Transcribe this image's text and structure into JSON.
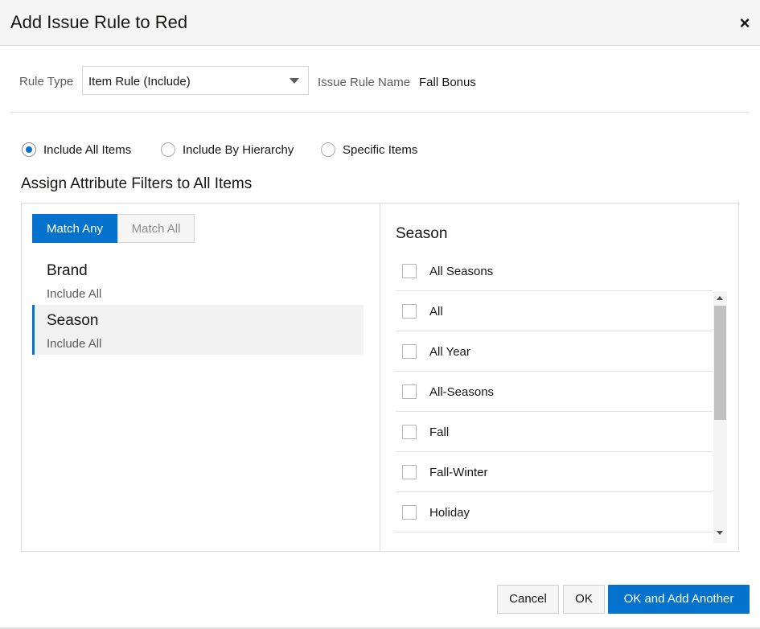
{
  "dialog": {
    "title": "Add Issue Rule to Red",
    "close_glyph": "×"
  },
  "form": {
    "rule_type_label": "Rule Type",
    "rule_type_value": "Item Rule (Include)",
    "issue_rule_name_label": "Issue Rule Name",
    "issue_rule_name_value": "Fall Bonus"
  },
  "radios": [
    {
      "label": "Include All Items",
      "checked": true
    },
    {
      "label": "Include By Hierarchy",
      "checked": false
    },
    {
      "label": "Specific Items",
      "checked": false
    }
  ],
  "section_title": "Assign Attribute Filters to All Items",
  "match": {
    "any_label": "Match Any",
    "all_label": "Match All",
    "selected": "any"
  },
  "attributes": [
    {
      "name": "Brand",
      "sub": "Include All",
      "selected": false
    },
    {
      "name": "Season",
      "sub": "Include All",
      "selected": true
    }
  ],
  "season_panel": {
    "title": "Season",
    "all_option": "All Seasons",
    "options": [
      {
        "label": "All",
        "checked": false
      },
      {
        "label": "All Year",
        "checked": false
      },
      {
        "label": "All-Seasons",
        "checked": false
      },
      {
        "label": "Fall",
        "checked": false
      },
      {
        "label": "Fall-Winter",
        "checked": false
      },
      {
        "label": "Holiday",
        "checked": false
      }
    ]
  },
  "footer": {
    "cancel_label": "Cancel",
    "ok_label": "OK",
    "ok_add_label": "OK and Add Another"
  },
  "colors": {
    "accent": "#0572ce",
    "header_bg": "#f5f5f5",
    "selected_bg": "#f1f1f1"
  }
}
